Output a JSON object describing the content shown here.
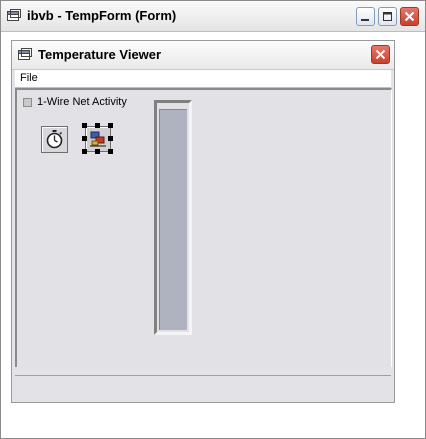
{
  "outer_window": {
    "title": "ibvb - TempForm (Form)",
    "title_icon": "form-window-icon",
    "buttons": [
      "minimize-icon",
      "maximize-icon",
      "close-icon"
    ]
  },
  "form": {
    "title": "Temperature Viewer",
    "title_icon": "form-window-icon",
    "close_icon": "close-icon",
    "menu": [
      {
        "label": "File"
      }
    ],
    "checkbox": {
      "label": "1-Wire Net Activity",
      "checked": false
    },
    "controls": [
      {
        "name": "timer-control",
        "icon": "stopwatch-icon",
        "selected": false
      },
      {
        "name": "ibutton-control",
        "icon": "ibutton-network-icon",
        "selected": true
      }
    ],
    "gauge": {
      "level": 0.98
    },
    "status": ""
  },
  "colors": {
    "form_background": "#e3e2e6",
    "gauge_fill": "#afb3c0",
    "close_button": "#c8402e"
  }
}
